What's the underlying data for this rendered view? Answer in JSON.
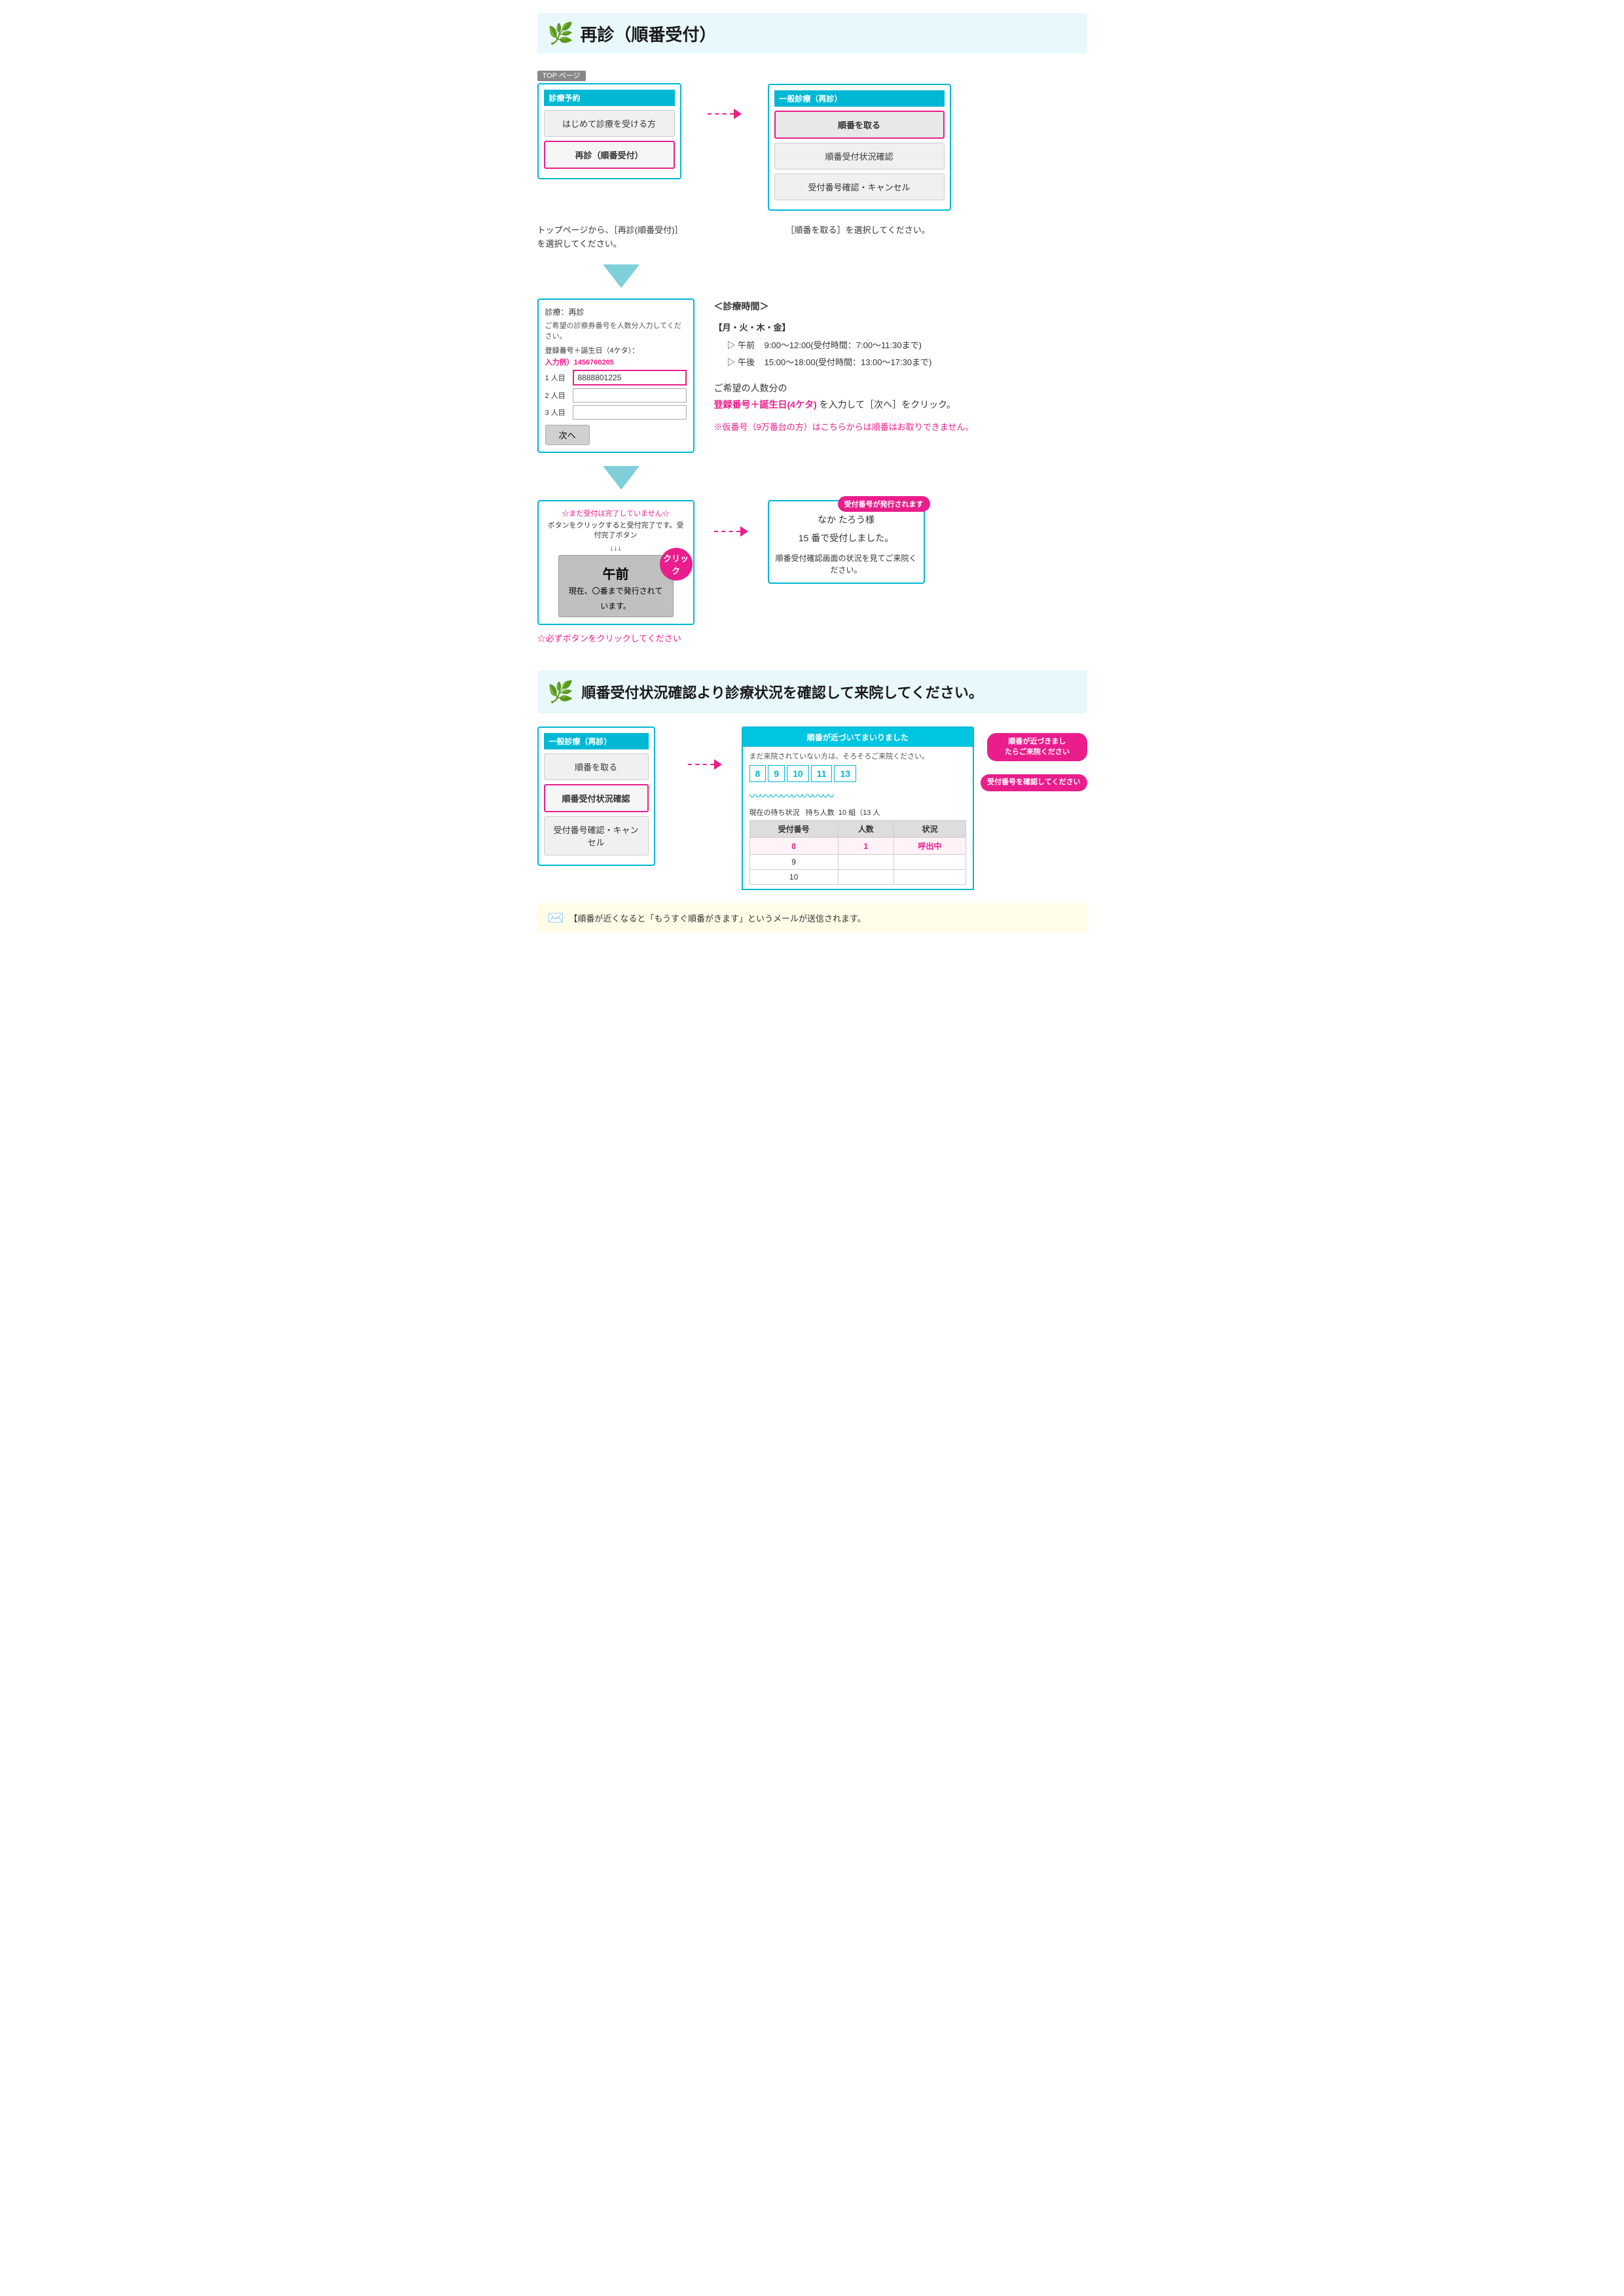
{
  "header": {
    "title": "再診（順番受付）",
    "icon": "🌿"
  },
  "section1": {
    "top_label": "TOP ページ",
    "left_screen": {
      "header": "診療予約",
      "btn1": "はじめて診療を受ける方",
      "btn2": "再診（順番受付）"
    },
    "right_screen": {
      "header": "一般診療（再診）",
      "btn1": "順番を取る",
      "btn2": "順番受付状況確認",
      "btn3": "受付番号確認・キャンセル"
    },
    "caption_left": "トップページから、［再診(順番受付)］を選択してください。",
    "caption_right": "［順番を取る］を選択してください。"
  },
  "section2": {
    "form_screen": {
      "title1": "診療：再診",
      "title2": "ご希望の診察券番号を人数分入力してください。",
      "entry_label": "登録番号＋誕生日（4ケタ）：",
      "example_label": "入力例）",
      "example_value": "1456760205",
      "row1_label": "1 人目",
      "row1_value": "8888801225",
      "row2_label": "2 人目",
      "row2_value": "",
      "row3_label": "3 人目",
      "row3_value": "",
      "next_btn": "次へ"
    },
    "info_heading": "＜診療時間＞",
    "weekday": "【月・火・木・金】",
    "time1_label": "▷ 午前",
    "time1_value": "9:00～12:00(受付時間：7:00～11:30まで)",
    "time2_label": "▷ 午後",
    "time2_value": "15:00～18:00(受付時間：13:00～17:30まで)",
    "instruction_text": "ご希望の人数分の",
    "instruction_highlight": "登録番号＋誕生日(4ケタ)",
    "instruction_text2": "を入力して［次へ］をクリック。",
    "warning": "※仮番号（9万番台の方）はこちらからは順番はお取りできません。"
  },
  "section3": {
    "confirm_screen": {
      "warning": "☆まだ受付は完了していません☆",
      "instruction": "ボタンをクリックすると受付完了です。受付完了ボタン",
      "arrows": "↓↓↓",
      "btn_label": "午前",
      "btn_sub": "現在、〇番まで発行されています。",
      "click_label": "クリック"
    },
    "result_screen": {
      "issued_label": "受付番号が発行されます",
      "name": "なか たろう様",
      "number_text": "15 番で受付しました。",
      "instruction": "順番受付確認画面の状況を見てご来院ください。"
    },
    "note": "☆必ずボタンをクリックしてください"
  },
  "section_divider": {
    "text": "順番受付状況確認より診療状況を確認して来院してください。",
    "icon": "🌿"
  },
  "section4": {
    "left_screen": {
      "header": "一般診療（再診）",
      "btn1": "順番を取る",
      "btn2_label": "順番受付状況確認",
      "btn3": "受付番号確認・キャンセル"
    },
    "status_popup": {
      "title": "順番が近づいてまいりました",
      "subtitle": "まだ来院されていない方は、そろそろご来院ください。",
      "numbers": [
        "8",
        "9",
        "10",
        "11",
        "13"
      ]
    },
    "current_status": {
      "label": "現在の待ち状況",
      "waiting": "持ち人数",
      "waiting_count": "10 組（13 人"
    },
    "table_headers": [
      "受付番号",
      "人数",
      "状況"
    ],
    "table_rows": [
      {
        "num": "8",
        "count": "1",
        "status": "呼出中",
        "highlight": true
      },
      {
        "num": "9",
        "count": "",
        "status": "",
        "highlight": false
      },
      {
        "num": "10",
        "count": "",
        "status": "",
        "highlight": false
      }
    ],
    "near_badge1": "順番が近づきましたらご来院ください",
    "confirm_badge": "受付番号を確認してください"
  },
  "footer_note": "【順番が近くなると「もうすぐ順番がきます」というメールが送信されます。"
}
